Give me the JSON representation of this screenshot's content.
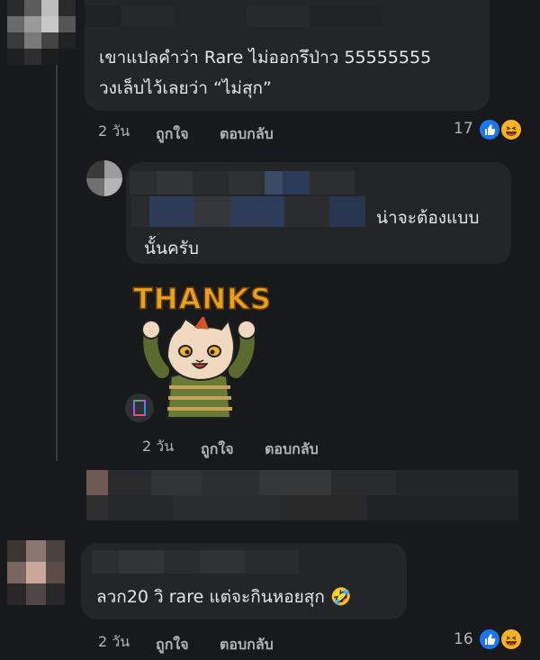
{
  "comments": [
    {
      "lines": [
        "เขาแปลคำว่า Rare ไม่ออกรึป่าว 55555555",
        "วงเล็บไว้เลยว่า “ไม่สุก”"
      ],
      "time": "2 วัน",
      "like_label": "ถูกใจ",
      "reply_label": "ตอบกลับ",
      "reaction_count": "17",
      "reactions": [
        "like-icon",
        "haha-icon"
      ]
    },
    {
      "lines": [
        "น่าจะต้องแบบ",
        "นั้นครับ"
      ],
      "sticker_text": "THANKS",
      "sticker_badge": "gif-icon",
      "time": "2 วัน",
      "like_label": "ถูกใจ",
      "reply_label": "ตอบกลับ"
    },
    {
      "lines": [
        "ลวก20 วิ rare แต่จะกินหอยสุก 🤣"
      ],
      "time": "2 วัน",
      "like_label": "ถูกใจ",
      "reply_label": "ตอบกลับ",
      "reaction_count": "16",
      "reactions": [
        "like-icon",
        "haha-icon"
      ]
    }
  ],
  "colors": {
    "background": "#18191a",
    "bubble": "#242526",
    "text": "#e4e6eb",
    "meta": "#b0b3b8",
    "like": "#1877f2",
    "haha": "#f7b125",
    "sticker_text": "#e8a020"
  }
}
